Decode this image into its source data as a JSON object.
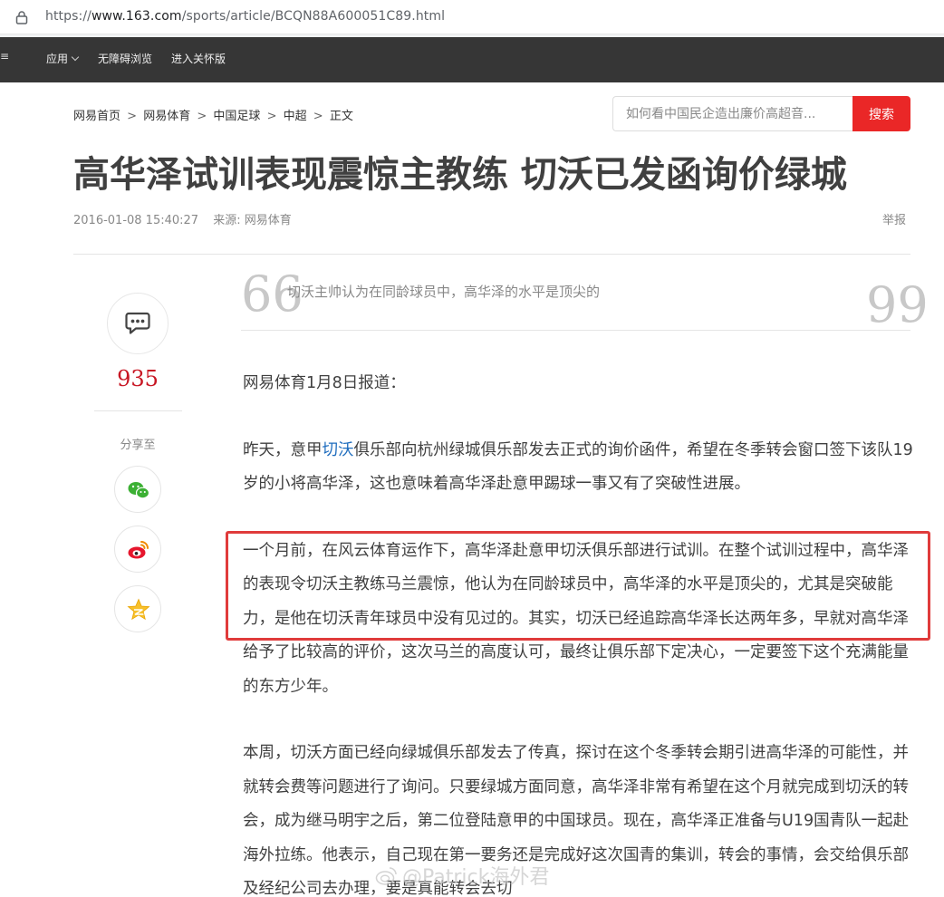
{
  "browser": {
    "url_prefix": "https://",
    "url_domain": "www.163.com",
    "url_path": "/sports/article/BCQN88A600051C89.html"
  },
  "topnav": {
    "edge_glyph": "≡",
    "items": [
      {
        "label": "应用"
      },
      {
        "label": "无障碍浏览"
      },
      {
        "label": "进入关怀版"
      }
    ]
  },
  "breadcrumb": {
    "items": [
      "网易首页",
      "网易体育",
      "中国足球",
      "中超",
      "正文"
    ],
    "separator": ">"
  },
  "search": {
    "placeholder": "如何看中国民企造出廉价高超音...",
    "button_label": "搜索"
  },
  "article": {
    "title": "高华泽试训表现震惊主教练 切沃已发函询价绿城",
    "datetime": "2016-01-08 15:40:27",
    "source": "来源: 网易体育",
    "report_label": "举报",
    "quote_open": "66",
    "quote": "切沃主帅认为在同龄球员中，高华泽的水平是顶尖的",
    "quote_close": "99",
    "paragraphs": {
      "p1": "网易体育1月8日报道：",
      "p2_before": "昨天，意甲",
      "p2_link": "切沃",
      "p2_after": "俱乐部向杭州绿城俱乐部发去正式的询价函件，希望在冬季转会窗口签下该队19岁的小将高华泽，这也意味着高华泽赴意甲踢球一事又有了突破性进展。",
      "p3": "一个月前，在风云体育运作下，高华泽赴意甲切沃俱乐部进行试训。在整个试训过程中，高华泽的表现令切沃主教练马兰震惊，他认为在同龄球员中，高华泽的水平是顶尖的，尤其是突破能力，是他在切沃青年球员中没有见过的。其实，切沃已经追踪高华泽长达两年多，早就对高华泽给予了比较高的评价，这次马兰的高度认可，最终让俱乐部下定决心，一定要签下这个充满能量的东方少年。",
      "p4": "本周，切沃方面已经向绿城俱乐部发去了传真，探讨在这个冬季转会期引进高华泽的可能性，并就转会费等问题进行了询问。只要绿城方面同意，高华泽非常有希望在这个月就完成到切沃的转会，成为继马明宇之后，第二位登陆意甲的中国球员。现在，高华泽正准备与U19国青队一起赴海外拉练。他表示，自己现在第一要务还是完成好这次国青的集训，转会的事情，会交给俱乐部及经纪公司去办理，要是真能转会去切"
    }
  },
  "sidebar": {
    "comment_count": "935",
    "share_label": "分享至",
    "share_targets": [
      "wechat-icon",
      "weibo-icon",
      "qzone-icon"
    ]
  },
  "watermark": {
    "text": "@Patrick海外君"
  },
  "colors": {
    "nav_bg": "#363636",
    "search_button": "#ea2727",
    "comment_count": "#c81623",
    "link": "#1f6dbe",
    "highlight_box": "#e03b3b"
  }
}
